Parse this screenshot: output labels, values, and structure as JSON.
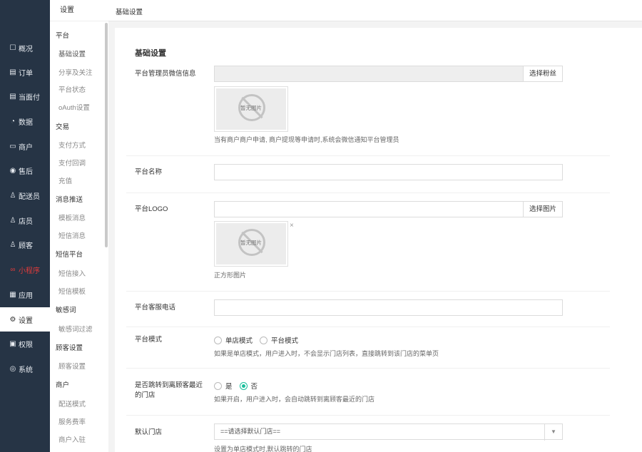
{
  "nav": [
    {
      "icon": "☐",
      "label": "概况"
    },
    {
      "icon": "▤",
      "label": "订单"
    },
    {
      "icon": "▤",
      "label": "当面付"
    },
    {
      "icon": "◔",
      "label": "数据"
    },
    {
      "icon": "▭",
      "label": "商户"
    },
    {
      "icon": "◉",
      "label": "售后"
    },
    {
      "icon": "♙",
      "label": "配送员"
    },
    {
      "icon": "♙",
      "label": "店员"
    },
    {
      "icon": "♙",
      "label": "顾客"
    },
    {
      "icon": "∞",
      "label": "小程序"
    },
    {
      "icon": "▦",
      "label": "应用"
    },
    {
      "icon": "⚙",
      "label": "设置"
    },
    {
      "icon": "▣",
      "label": "权限"
    },
    {
      "icon": "◎",
      "label": "系统"
    }
  ],
  "submenu": {
    "title": "设置",
    "groups": [
      {
        "label": "平台",
        "items": [
          "基础设置",
          "分享及关注",
          "平台状态",
          "oAuth设置"
        ]
      },
      {
        "label": "交易",
        "items": [
          "支付方式",
          "支付回调",
          "充值"
        ]
      },
      {
        "label": "消息推送",
        "items": [
          "模板消息",
          "短信消息"
        ]
      },
      {
        "label": "短信平台",
        "items": [
          "短信接入",
          "短信模板"
        ]
      },
      {
        "label": "敏感词",
        "items": [
          "敏感词过滤"
        ]
      },
      {
        "label": "顾客设置",
        "items": [
          "顾客设置"
        ]
      },
      {
        "label": "商户",
        "items": [
          "配送模式",
          "服务费率",
          "商户入驻"
        ]
      }
    ]
  },
  "header": {
    "breadcrumb": "基础设置"
  },
  "form": {
    "section_title": "基础设置",
    "admin_wechat": {
      "label": "平台管理员微信信息",
      "value": "",
      "button": "选择粉丝",
      "help": "当有商户商户申请, 商户提现等申请时,系统会微信通知平台管理员"
    },
    "no_image_text": "暂无图片",
    "platform_name": {
      "label": "平台名称",
      "value": ""
    },
    "platform_logo": {
      "label": "平台LOGO",
      "value": "",
      "button": "选择图片",
      "close": "×",
      "help": "正方形图片"
    },
    "service_phone": {
      "label": "平台客服电话",
      "value": ""
    },
    "platform_mode": {
      "label": "平台模式",
      "options": [
        "单店模式",
        "平台模式"
      ],
      "selected": "",
      "help": "如果是单店模式，用户进入时，不会显示门店列表，直接跳转到该门店的菜单页"
    },
    "jump_nearest": {
      "label": "是否跳转到离顾客最近的门店",
      "options": [
        "是",
        "否"
      ],
      "selected": "否",
      "help": "如果开启，用户进入时，会自动跳转到离顾客最近的门店"
    },
    "default_store": {
      "label": "默认门店",
      "value": "==请选择默认门店==",
      "arrow": "▼",
      "help": "设置为单店模式时,默认跳转的门店"
    }
  },
  "colors": {
    "nav_bg": "#263445",
    "accent": "#19be9b",
    "highlight": "#e23b3b"
  }
}
